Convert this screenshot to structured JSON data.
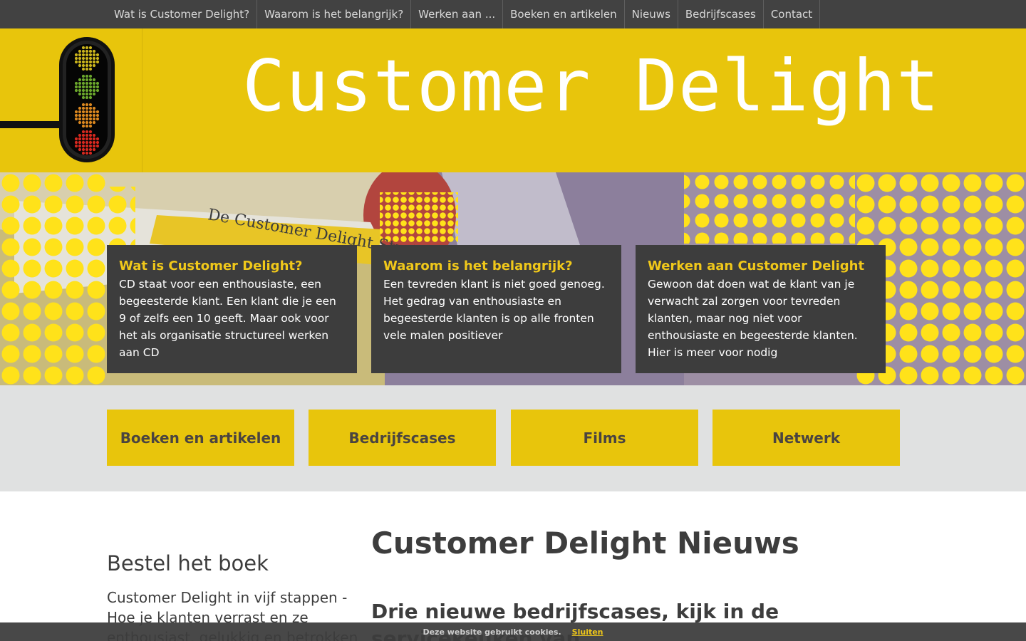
{
  "nav": {
    "items": [
      "Wat is Customer Delight?",
      "Waarom is het belangrijk?",
      "Werken aan ...",
      "Boeken en artikelen",
      "Nieuws",
      "Bedrijfscases",
      "Contact"
    ]
  },
  "header": {
    "title": "Customer Delight",
    "logo_icon": "traffic-light-icon"
  },
  "hero": {
    "book_cover_text": "De Customer Delight Strategie",
    "cards": [
      {
        "title": "Wat is Customer Delight?",
        "text": "CD staat voor een enthousiaste, een begeesterde klant. Een klant die je een 9 of zelfs een 10 geeft. Maar ook voor het als organisatie structureel werken aan CD"
      },
      {
        "title": "Waarom is het belangrijk?",
        "text": "Een tevreden klant is niet goed genoeg. Het gedrag van enthousiaste en begeesterde klanten is op alle fronten vele malen positiever"
      },
      {
        "title": "Werken aan Customer Delight",
        "text": "Gewoon dat doen wat de klant van je verwacht zal zorgen voor tevreden klanten, maar nog niet voor enthousiaste en begeesterde klanten. Hier is meer voor nodig"
      }
    ]
  },
  "tiles": [
    "Boeken en artikelen",
    "Bedrijfscases",
    "Films",
    "Netwerk"
  ],
  "sidebar": {
    "title": "Bestel het boek",
    "text": "Customer Delight in vijf stappen - Hoe je klanten verrast en ze enthousiast, gelukkig en betrokken"
  },
  "main": {
    "title": "Customer Delight Nieuws",
    "news_title": "Drie nieuwe bedrijfscases, kijk in de servicekeuken van"
  },
  "cookie": {
    "text": "Deze website gebruikt cookies.",
    "close_label": "Sluiten"
  },
  "colors": {
    "accent_yellow": "#e8c50c",
    "dark_gray": "#3d3d3d",
    "nav_bg": "#424242",
    "tiles_bg": "#e0e1e1"
  }
}
